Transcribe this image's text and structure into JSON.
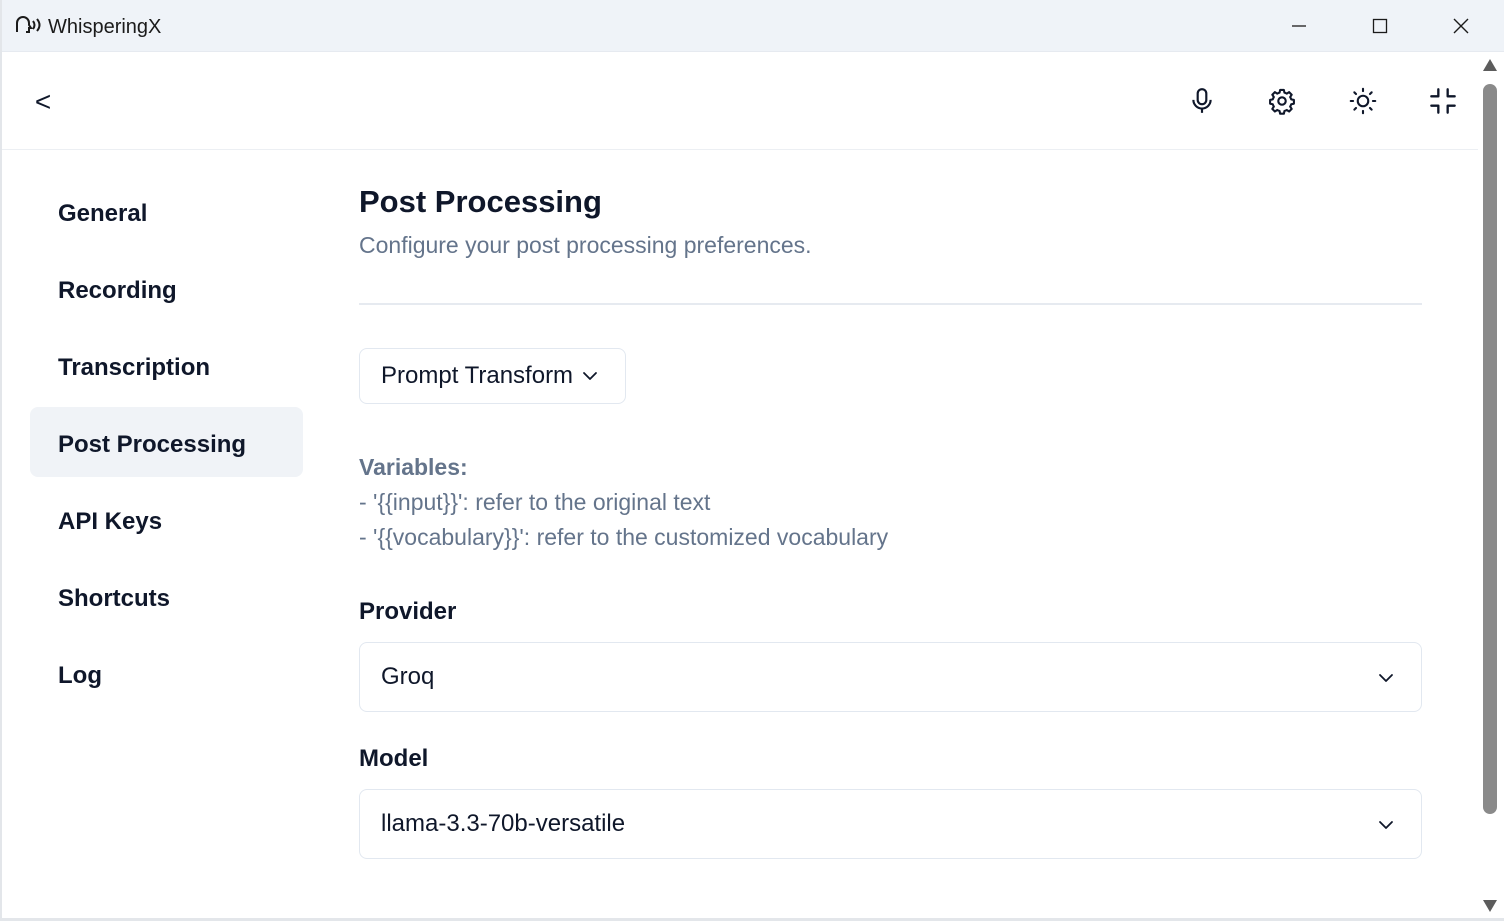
{
  "window": {
    "title": "WhisperingX",
    "app_icon": "whisper-head-icon",
    "controls": [
      "minimize-icon",
      "maximize-icon",
      "close-icon"
    ]
  },
  "header": {
    "back_label": "<",
    "tools": [
      "microphone-icon",
      "gear-icon",
      "sun-icon",
      "minimize-arrows-icon"
    ]
  },
  "sidebar": {
    "items": [
      {
        "label": "General",
        "active": false
      },
      {
        "label": "Recording",
        "active": false
      },
      {
        "label": "Transcription",
        "active": false
      },
      {
        "label": "Post Processing",
        "active": true
      },
      {
        "label": "API Keys",
        "active": false
      },
      {
        "label": "Shortcuts",
        "active": false
      },
      {
        "label": "Log",
        "active": false
      }
    ]
  },
  "main": {
    "title": "Post Processing",
    "subtitle": "Configure your post processing preferences.",
    "mode_select": {
      "value": "Prompt Transform"
    },
    "variables": {
      "title": "Variables:",
      "lines": [
        "- '{{input}}': refer to the original text",
        "- '{{vocabulary}}': refer to the customized vocabulary"
      ]
    },
    "provider": {
      "label": "Provider",
      "value": "Groq"
    },
    "model": {
      "label": "Model",
      "value": "llama-3.3-70b-versatile"
    }
  },
  "colors": {
    "titlebar_bg": "#eff3f8",
    "active_nav_bg": "#f0f3f7",
    "muted_text": "#64748b",
    "border": "#e2e8f0"
  }
}
